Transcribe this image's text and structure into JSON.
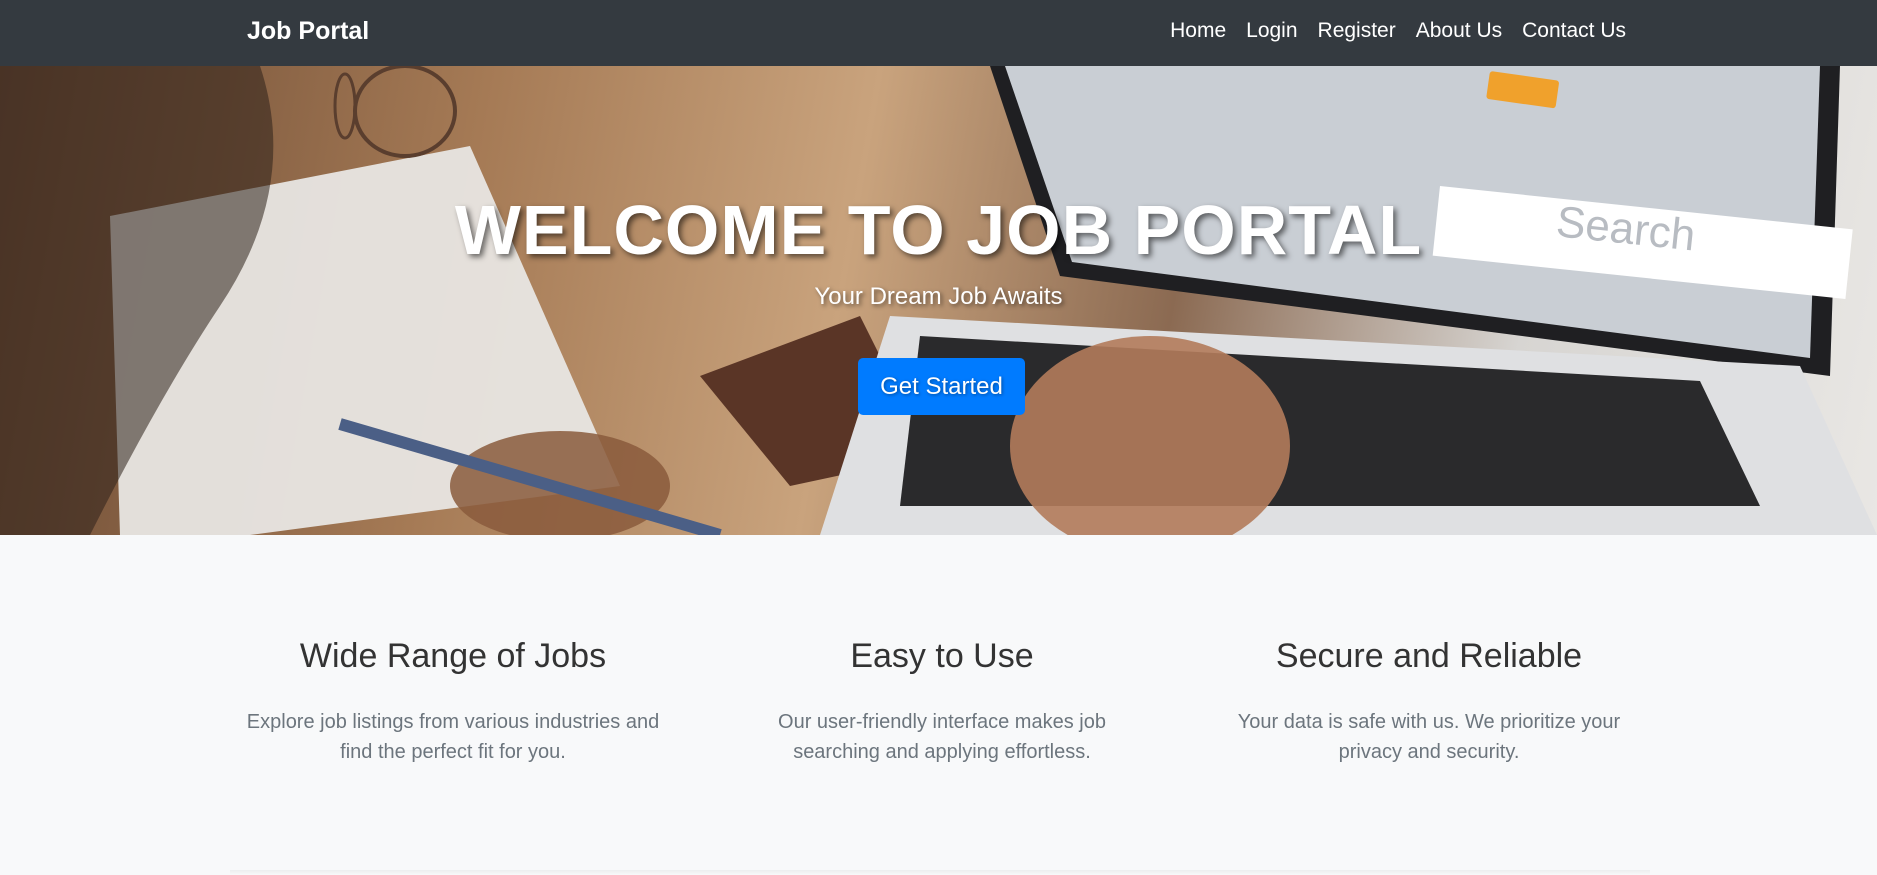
{
  "navbar": {
    "brand": "Job Portal",
    "links": [
      "Home",
      "Login",
      "Register",
      "About Us",
      "Contact Us"
    ]
  },
  "hero": {
    "title": "WELCOME TO JOB PORTAL",
    "subtitle": "Your Dream Job Awaits",
    "cta_label": "Get Started"
  },
  "features": [
    {
      "title": "Wide Range of Jobs",
      "text": "Explore job listings from various industries and find the perfect fit for you."
    },
    {
      "title": "Easy to Use",
      "text": "Our user-friendly interface makes job searching and applying effortless."
    },
    {
      "title": "Secure and Reliable",
      "text": "Your data is safe with us. We prioritize your privacy and security."
    }
  ],
  "colors": {
    "navbar": "#343a40",
    "accent": "#007bff",
    "background": "#f8f9fa"
  }
}
